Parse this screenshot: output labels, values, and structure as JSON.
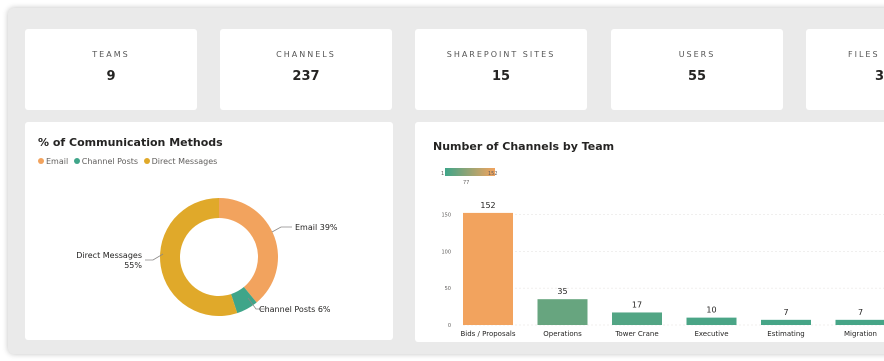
{
  "kpis": [
    {
      "label": "TEAMS",
      "value": "9"
    },
    {
      "label": "CHANNELS",
      "value": "237"
    },
    {
      "label": "SHAREPOINT SITES",
      "value": "15"
    },
    {
      "label": "USERS",
      "value": "55"
    },
    {
      "label": "FILES",
      "value": "3"
    }
  ],
  "colors": {
    "email": "#f2a35e",
    "channel_posts": "#3fa589",
    "direct_messages": "#e0a92a",
    "bar_top": "#f2a35e",
    "bar_bottom": "#3fa589"
  },
  "chart_data": [
    {
      "type": "pie",
      "title": "% of Communication Methods",
      "legend": [
        "Email",
        "Channel Posts",
        "Direct Messages"
      ],
      "slices": [
        {
          "name": "Email",
          "value": 39,
          "label": "Email 39%"
        },
        {
          "name": "Channel Posts",
          "value": 6,
          "label": "Channel Posts 6%"
        },
        {
          "name": "Direct Messages",
          "value": 55,
          "label_line1": "Direct Messages",
          "label_line2": "55%"
        }
      ],
      "donut": true
    },
    {
      "type": "bar",
      "title": "Number of Channels by Team",
      "gradient_legend": {
        "min": "1",
        "max": "152",
        "mid": "77"
      },
      "categories": [
        "Bids / Proposals",
        "Operations",
        "Tower Crane",
        "Executive",
        "Estimating",
        "Migration"
      ],
      "values": [
        152,
        35,
        17,
        10,
        7,
        7
      ],
      "y_ticks": [
        "150",
        "100",
        "50",
        "0"
      ],
      "ylim": [
        0,
        160
      ],
      "grid": true
    }
  ]
}
